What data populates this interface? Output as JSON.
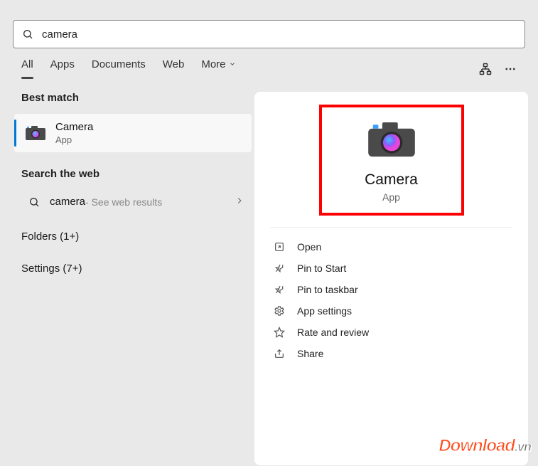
{
  "search": {
    "query": "camera"
  },
  "tabs": {
    "all": "All",
    "apps": "Apps",
    "documents": "Documents",
    "web": "Web",
    "more": "More"
  },
  "left": {
    "bestMatchTitle": "Best match",
    "bestItem": {
      "name": "Camera",
      "type": "App"
    },
    "searchWebTitle": "Search the web",
    "webResult": {
      "query": "camera",
      "hint": " - See web results"
    },
    "folders": "Folders (1+)",
    "settings": "Settings (7+)"
  },
  "right": {
    "heroTitle": "Camera",
    "heroSub": "App",
    "actions": {
      "open": "Open",
      "pinStart": "Pin to Start",
      "pinTaskbar": "Pin to taskbar",
      "appSettings": "App settings",
      "rate": "Rate and review",
      "share": "Share"
    }
  },
  "watermark": {
    "main": "Download",
    "suffix": ".vn"
  }
}
